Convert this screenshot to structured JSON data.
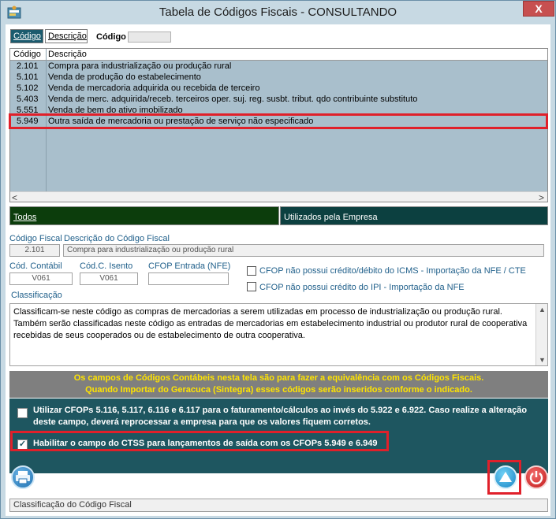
{
  "window": {
    "title": "Tabela de Códigos Fiscais   -   CONSULTANDO",
    "close_label": "X"
  },
  "search": {
    "tabs": [
      "Código",
      "Descrição"
    ],
    "label": "Código",
    "value": ""
  },
  "grid": {
    "headers": [
      "Código",
      "Descrição"
    ],
    "rows": [
      {
        "code": "2.101",
        "desc": "Compra para industrialização ou produção rural"
      },
      {
        "code": "5.101",
        "desc": "Venda de produção do estabelecimento"
      },
      {
        "code": "5.102",
        "desc": "Venda de mercadoria adquirida ou recebida de terceiro"
      },
      {
        "code": "5.403",
        "desc": "Venda de merc. adquirida/receb. terceiros oper. suj. reg. susbt. tribut. qdo contribuinte substituto"
      },
      {
        "code": "5.551",
        "desc": "Venda de bem do ativo imobilizado"
      },
      {
        "code": "5.949",
        "desc": "Outra saída de mercadoria ou prestação de serviço não especificado"
      }
    ],
    "scroll_left": "<",
    "scroll_right": ">"
  },
  "filters": {
    "todos": "Todos",
    "utilizados": "Utilizados pela Empresa"
  },
  "details": {
    "codigo_fiscal_label": "Código Fiscal",
    "codigo_fiscal_value": "2.101",
    "descricao_label": "Descrição do Código Fiscal",
    "descricao_value": "Compra para industrialização ou produção rural",
    "cod_contabil_label": "Cód. Contábil",
    "cod_contabil_value": "V061",
    "cod_isento_label": "Cód.C. Isento",
    "cod_isento_value": "V061",
    "cfop_entrada_label": "CFOP Entrada (NFE)",
    "cfop_entrada_value": "",
    "chk_icms_label": "CFOP não possui crédito/débito do ICMS -  Importação da NFE / CTE",
    "chk_ipi_label": "CFOP não possui crédito do IPI -  Importação da NFE"
  },
  "classificacao": {
    "label": "Classificação",
    "text": "Classificam-se neste código as compras de mercadorias a serem utilizadas em processo de industrialização ou produção rural. Também serão classificadas neste código as entradas de mercadorias em estabelecimento industrial ou produtor rural de cooperativa recebidas de seus cooperados ou de estabelecimento de outra cooperativa."
  },
  "notice": {
    "line1": "Os campos de Códigos Contábeis nesta tela são para fazer a equivalência com os Códigos Fiscais.",
    "line2": "Quando Importar do Geracuca (Sintegra) esses códigos serão inseridos conforme o indicado."
  },
  "options": {
    "opt1": "Utilizar CFOPs 5.116, 5.117, 6.116 e 6.117 para o faturamento/cálculos ao invés do 5.922 e 6.922. Caso realize a alteração deste campo, deverá reprocessar a empresa para que os valores fiquem corretos.",
    "opt2": "Habilitar o campo do CTSS para lançamentos de saída com os CFOPs 5.949 e 6.949",
    "opt2_checked": true
  },
  "status": {
    "text": "Classificação do Código Fiscal"
  }
}
